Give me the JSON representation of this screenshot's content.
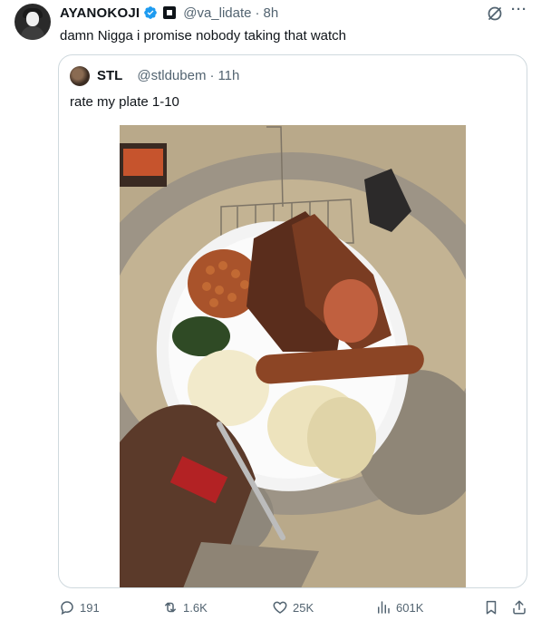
{
  "tweet": {
    "display_name": "AYANOKOJI",
    "handle": "@va_lidate",
    "separator": "·",
    "time": "8h",
    "text": "damn Nigga i promise nobody taking that watch",
    "more_label": "···"
  },
  "quote": {
    "display_name": "STL",
    "handle": "@stldubem",
    "separator": "·",
    "time": "11h",
    "text": "rate my plate 1-10"
  },
  "actions": {
    "replies": "191",
    "reposts": "1.6K",
    "likes": "25K",
    "views": "601K"
  },
  "colors": {
    "text": "#0f1419",
    "secondary": "#536471",
    "border": "#cfd9de",
    "verified": "#1d9bf0"
  },
  "icons": [
    "verified-badge-icon",
    "affiliate-badge-icon",
    "grok-icon",
    "more-icon",
    "reply-icon",
    "repost-icon",
    "like-icon",
    "views-icon",
    "bookmark-icon",
    "share-icon"
  ]
}
